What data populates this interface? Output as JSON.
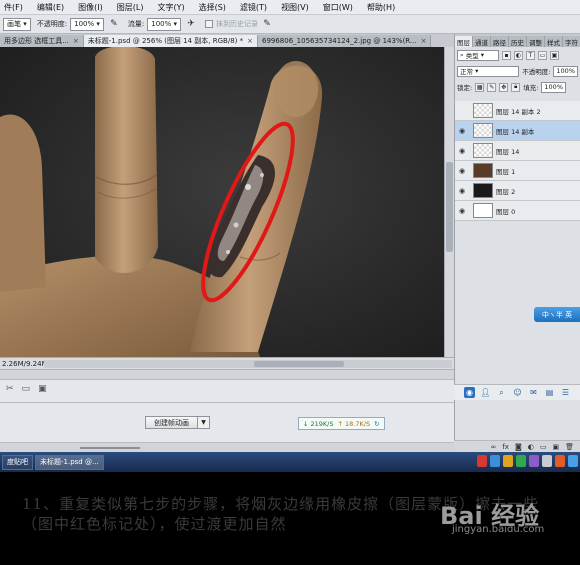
{
  "menubar": {
    "items": [
      "件(F)",
      "编辑(E)",
      "图像(I)",
      "图层(L)",
      "文字(Y)",
      "选择(S)",
      "滤镜(T)",
      "视图(V)",
      "窗口(W)",
      "帮助(H)"
    ]
  },
  "options": {
    "mode_value": "画笔",
    "opacity_label": "不透明度:",
    "opacity_value": "100%",
    "flow_label": "流量:",
    "flow_value": "100%",
    "erase_history_label": "抹到历史记录"
  },
  "tabs": [
    {
      "label": "用多边形 选框工具...",
      "active": false
    },
    {
      "label": "未标题-1.psd @ 256% (图层 14 副本, RGB/8) *",
      "active": true
    },
    {
      "label": "6996806_105635734124_2.jpg @ 143%(R...",
      "active": false
    }
  ],
  "status": {
    "doc_size": "2.26M/9.24M"
  },
  "timeline": {
    "create_animation_label": "创建帧动画",
    "net_up": "↓ 219K/S",
    "net_down": "↑ 18.7K/S"
  },
  "right_panel": {
    "tabs": [
      "图层",
      "通道",
      "路径",
      "历史",
      "调整",
      "样式",
      "字符",
      "段落"
    ],
    "kind_label": "类型",
    "blend_mode": "正常",
    "opacity_label": "不透明度:",
    "opacity_value": "100%",
    "lock_label": "锁定:",
    "fill_label": "填充:",
    "fill_value": "100%",
    "layers": [
      {
        "name": "图层 14 副本 2",
        "visible": false,
        "selected": false,
        "thumb": "trans"
      },
      {
        "name": "图层 14 副本",
        "visible": true,
        "selected": true,
        "thumb": "trans"
      },
      {
        "name": "图层 14",
        "visible": true,
        "selected": false,
        "thumb": "trans"
      },
      {
        "name": "图层 1",
        "visible": true,
        "selected": false,
        "thumb": "hand"
      },
      {
        "name": "图层 2",
        "visible": true,
        "selected": false,
        "thumb": "dark"
      },
      {
        "name": "图层 0",
        "visible": true,
        "selected": false,
        "thumb": "white"
      }
    ],
    "float_button_label": "中ヽ半 英"
  },
  "taskbar": {
    "items": [
      "度贴吧",
      "未标题-1.psd @..."
    ]
  },
  "caption": {
    "text": "11、重复类似第七步的步骤，将烟灰边缘用橡皮擦（图层蒙版）擦去一些（图中红色标记处），使过渡更加自然",
    "watermark_logo": "Bai 经验",
    "watermark_url": "jingyan.baidu.com"
  },
  "colors": {
    "highlight_ring": "#e01818",
    "selected_layer": "#b9d2ee",
    "taskbar": "#1f3a66"
  }
}
